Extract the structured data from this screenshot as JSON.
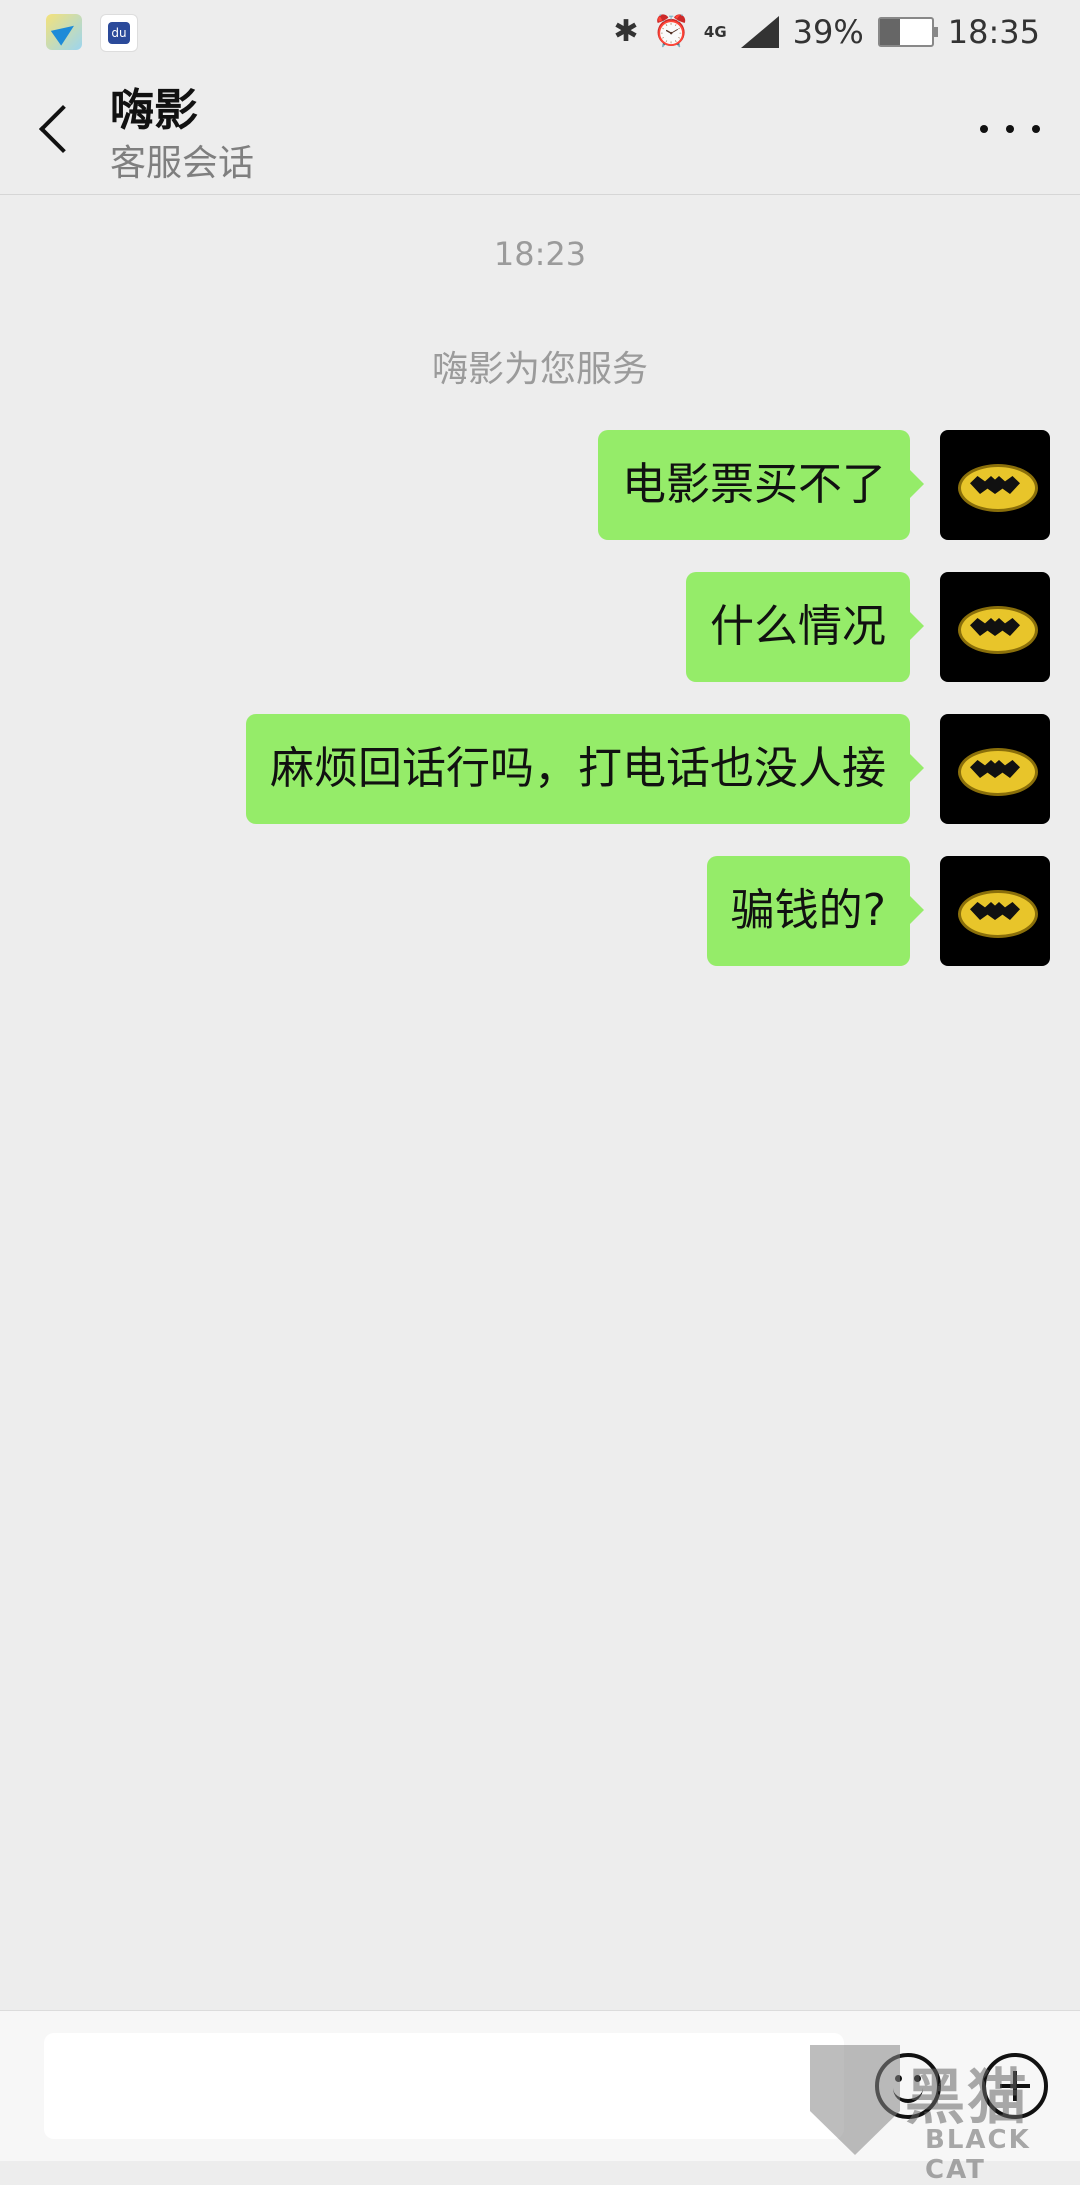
{
  "status_bar": {
    "battery_percent": "39%",
    "battery_level": 0.39,
    "time": "18:35",
    "network": "4G",
    "icons": [
      "bluetooth-icon",
      "alarm-icon",
      "signal-icon",
      "battery-icon"
    ]
  },
  "header": {
    "title": "嗨影",
    "subtitle": "客服会话"
  },
  "chat": {
    "timestamp": "18:23",
    "system_message": "嗨影为您服务",
    "messages": [
      {
        "text": "电影票买不了",
        "sender": "self"
      },
      {
        "text": "什么情况",
        "sender": "self"
      },
      {
        "text": "麻烦回话行吗，打电话也没人接",
        "sender": "self"
      },
      {
        "text": "骗钱的?",
        "sender": "self"
      }
    ]
  },
  "input_bar": {
    "value": "",
    "placeholder": ""
  },
  "watermark": {
    "zh": "黑猫",
    "en": "BLACK CAT"
  },
  "colors": {
    "background": "#ededed",
    "bubble_self": "#95ec69"
  }
}
